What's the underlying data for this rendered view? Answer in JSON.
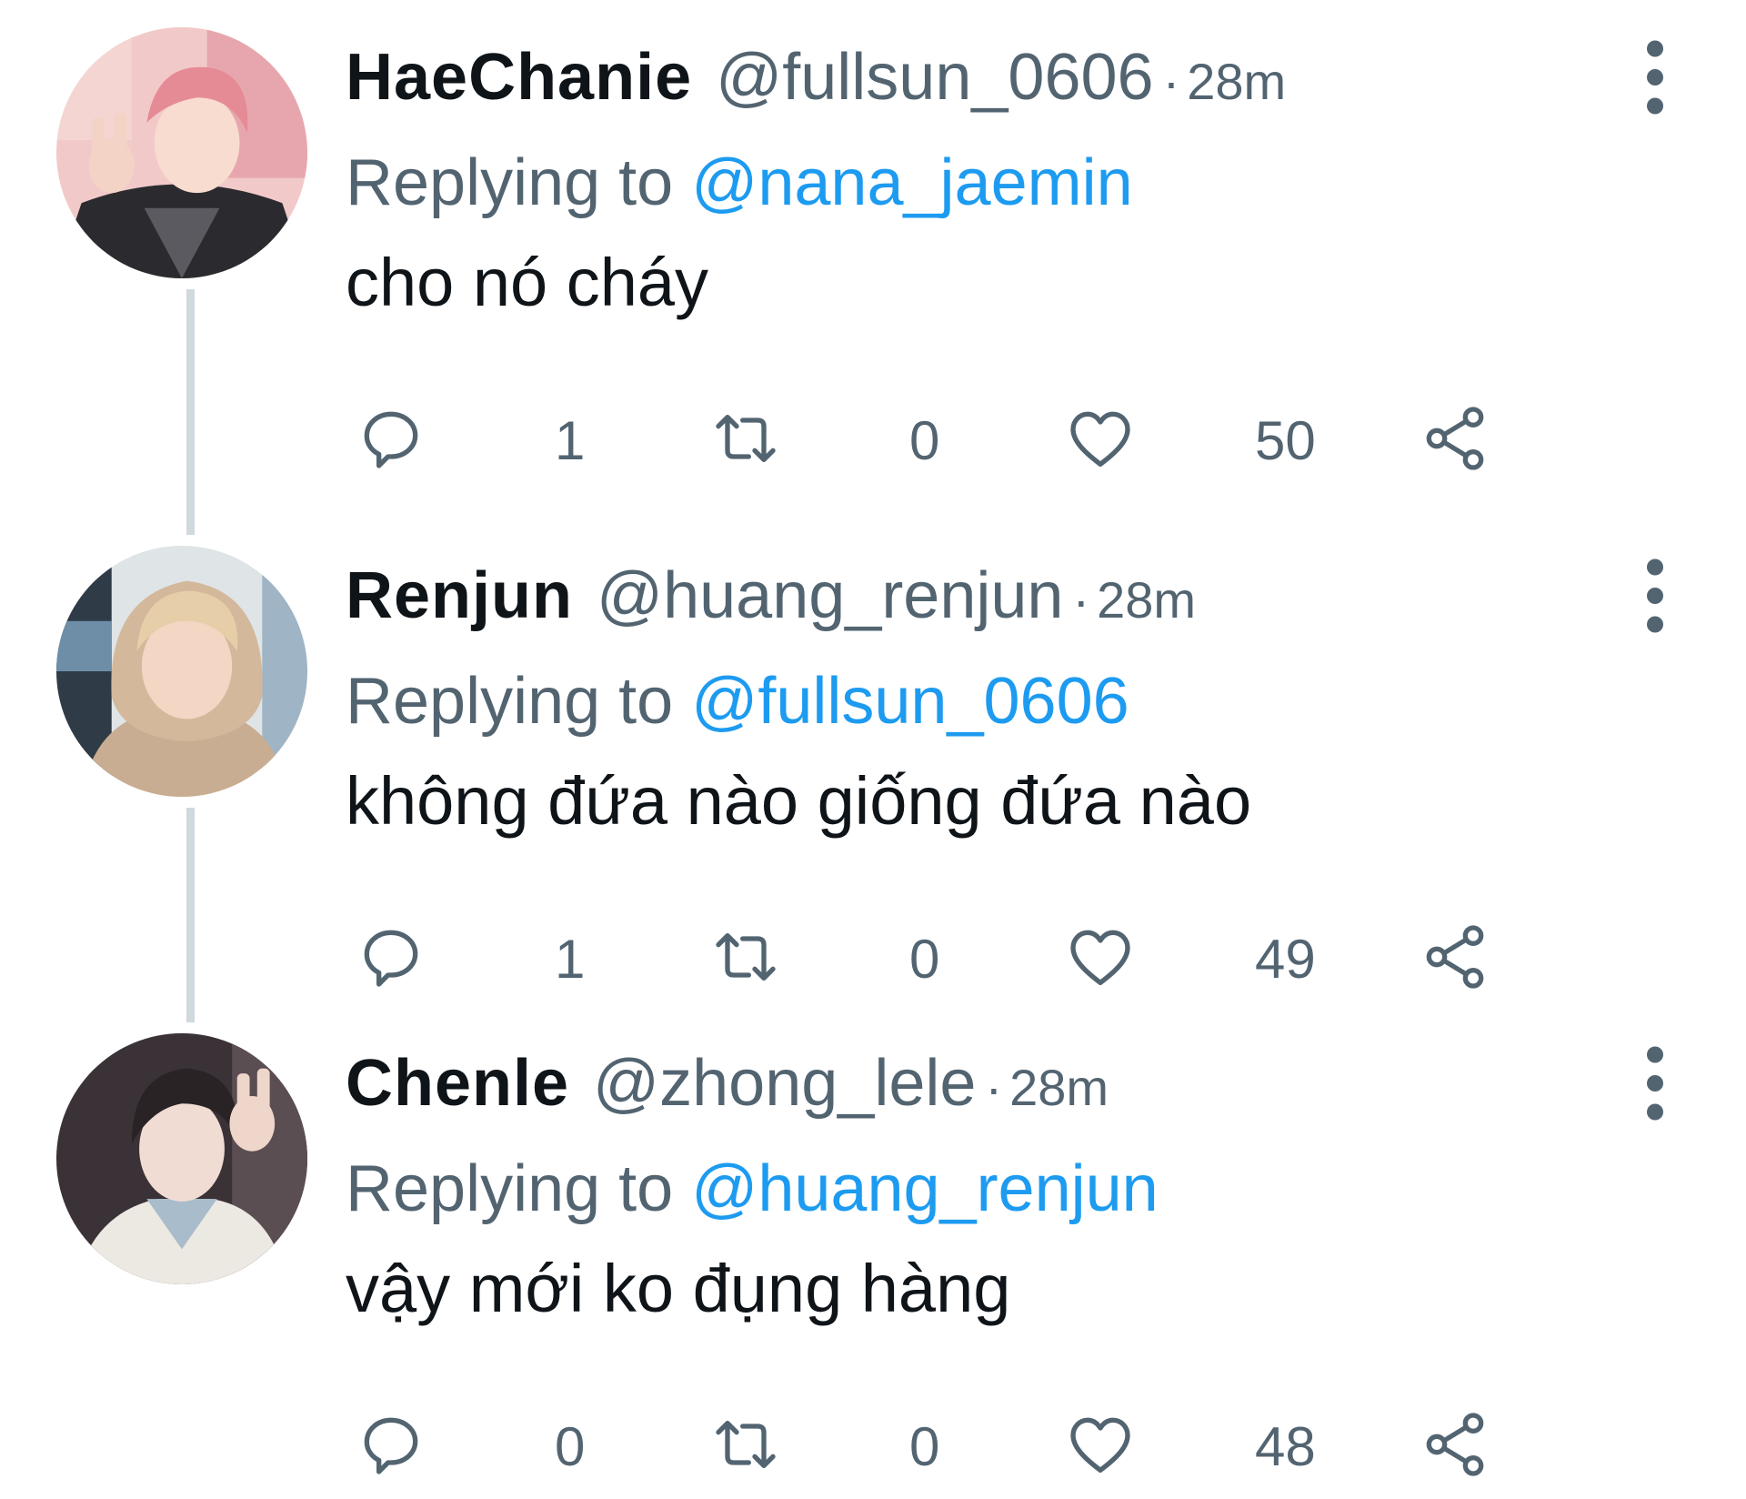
{
  "tweets": [
    {
      "display_name": "HaeChanie",
      "handle": "@fullsun_0606",
      "separator": "·",
      "time": "28m",
      "replying_prefix": "Replying to",
      "replying_to": "@nana_jaemin",
      "text": "cho nó cháy",
      "reply_count": "1",
      "retweet_count": "0",
      "like_count": "50"
    },
    {
      "display_name": "Renjun",
      "handle": "@huang_renjun",
      "separator": "·",
      "time": "28m",
      "replying_prefix": "Replying to",
      "replying_to": "@fullsun_0606",
      "text": "không đứa nào giống đứa nào",
      "reply_count": "1",
      "retweet_count": "0",
      "like_count": "49"
    },
    {
      "display_name": "Chenle",
      "handle": "@zhong_lele",
      "separator": "·",
      "time": "28m",
      "replying_prefix": "Replying to",
      "replying_to": "@huang_renjun",
      "text": "vậy mới ko đụng hàng",
      "reply_count": "0",
      "retweet_count": "0",
      "like_count": "48"
    }
  ],
  "colors": {
    "name": "#0f1419",
    "secondary": "#536471",
    "mention": "#1d9bf0",
    "thread_line": "#cfd9de"
  },
  "icons": {
    "reply": "reply-icon",
    "retweet": "retweet-icon",
    "like": "heart-icon",
    "share": "share-icon",
    "more": "more-vertical-icon"
  }
}
